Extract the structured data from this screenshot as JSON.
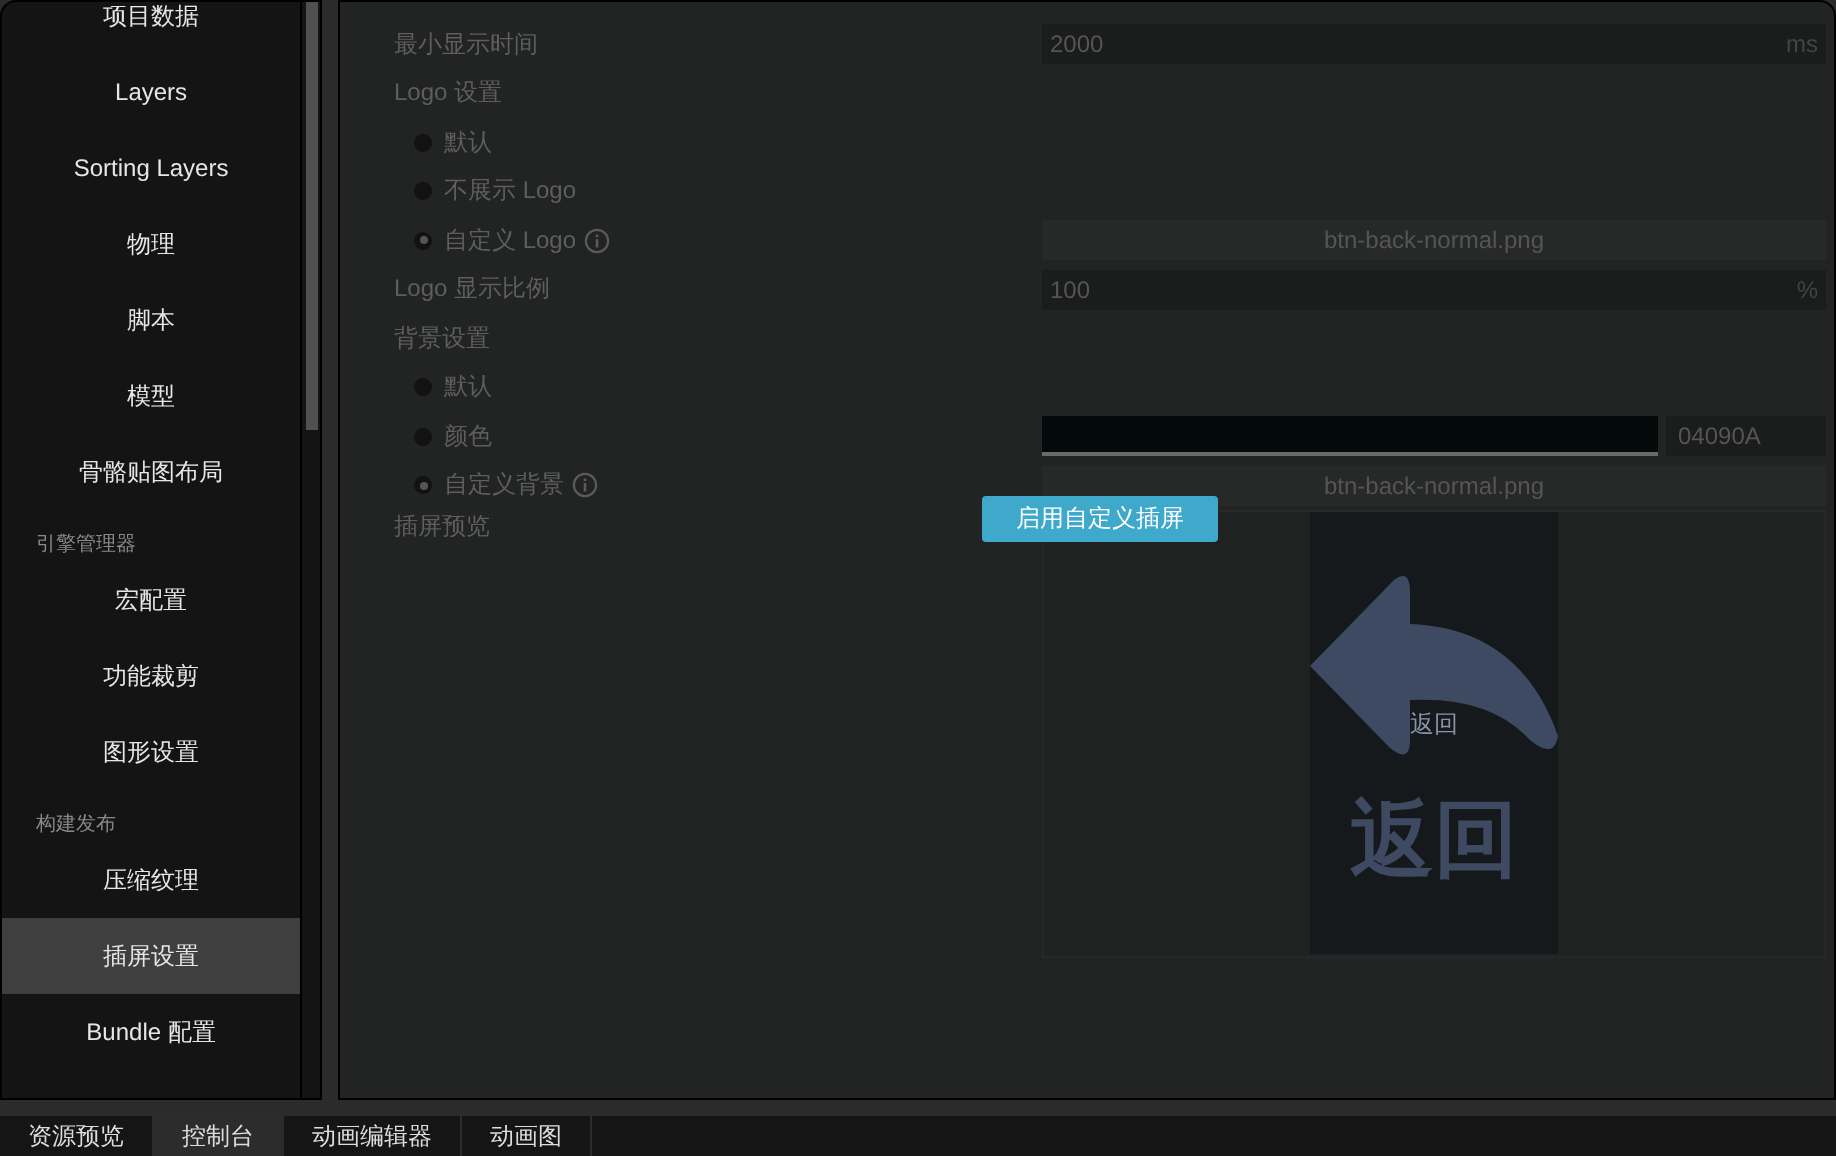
{
  "sidebar": {
    "items": [
      {
        "kind": "item",
        "label": "项目数据",
        "selected": false
      },
      {
        "kind": "item",
        "label": "Layers",
        "selected": false
      },
      {
        "kind": "item",
        "label": "Sorting Layers",
        "selected": false
      },
      {
        "kind": "item",
        "label": "物理",
        "selected": false
      },
      {
        "kind": "item",
        "label": "脚本",
        "selected": false
      },
      {
        "kind": "item",
        "label": "模型",
        "selected": false
      },
      {
        "kind": "item",
        "label": "骨骼贴图布局",
        "selected": false
      },
      {
        "kind": "header",
        "label": "引擎管理器"
      },
      {
        "kind": "item",
        "label": "宏配置",
        "selected": false
      },
      {
        "kind": "item",
        "label": "功能裁剪",
        "selected": false
      },
      {
        "kind": "item",
        "label": "图形设置",
        "selected": false
      },
      {
        "kind": "header",
        "label": "构建发布"
      },
      {
        "kind": "item",
        "label": "压缩纹理",
        "selected": false
      },
      {
        "kind": "item",
        "label": "插屏设置",
        "selected": true
      },
      {
        "kind": "item",
        "label": "Bundle 配置",
        "selected": false
      }
    ]
  },
  "settings": {
    "rows": [
      {
        "kind": "number",
        "label": "最小显示时间",
        "value": "2000",
        "unit": "ms"
      },
      {
        "kind": "heading",
        "label": "Logo 设置"
      },
      {
        "kind": "radio",
        "label": "默认",
        "selected": false
      },
      {
        "kind": "radio",
        "label": "不展示 Logo",
        "selected": false
      },
      {
        "kind": "radio",
        "label": "自定义 Logo",
        "selected": true,
        "info": true,
        "file": "btn-back-normal.png"
      },
      {
        "kind": "number",
        "label": "Logo 显示比例",
        "value": "100",
        "unit": "%"
      },
      {
        "kind": "heading",
        "label": "背景设置"
      },
      {
        "kind": "radio",
        "label": "默认",
        "selected": false
      },
      {
        "kind": "radio",
        "label": "颜色",
        "selected": false,
        "color": "#04090a",
        "hex": "04090A"
      },
      {
        "kind": "radio",
        "label": "自定义背景",
        "selected": true,
        "info": true,
        "file": "btn-back-normal.png"
      },
      {
        "kind": "preview",
        "label": "插屏预览",
        "small_text": "返回",
        "large_text": "返回"
      }
    ],
    "enable_button": "启用自定义插屏"
  },
  "bottom_tabs": [
    {
      "label": "资源预览",
      "selected": false
    },
    {
      "label": "控制台",
      "selected": true
    },
    {
      "label": "动画编辑器",
      "selected": false
    },
    {
      "label": "动画图",
      "selected": false
    }
  ]
}
